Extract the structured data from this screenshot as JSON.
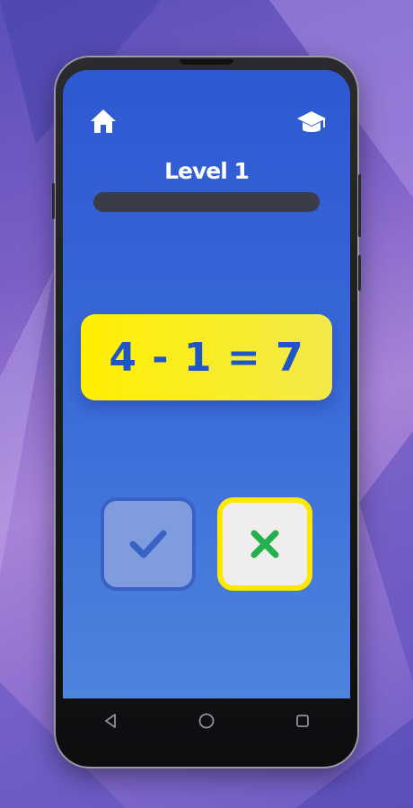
{
  "header": {
    "home_icon": "home-icon",
    "learn_icon": "graduation-cap-icon"
  },
  "level": {
    "title": "Level 1",
    "progress": 0
  },
  "question": {
    "equation": "4 - 1 = 7"
  },
  "answers": {
    "true_icon": "checkmark-icon",
    "false_icon": "cross-icon"
  },
  "colors": {
    "screen_top": "#2d59d2",
    "screen_bottom": "#4d84de",
    "card_yellow": "#ffef00",
    "equation_blue": "#1f56c6",
    "check_blue": "#3a62c4",
    "cross_green": "#23b14d",
    "highlight_yellow": "#ffe800"
  },
  "system_nav": {
    "back_icon": "back-triangle-icon",
    "home_icon": "home-circle-icon",
    "recents_icon": "recents-square-icon"
  }
}
